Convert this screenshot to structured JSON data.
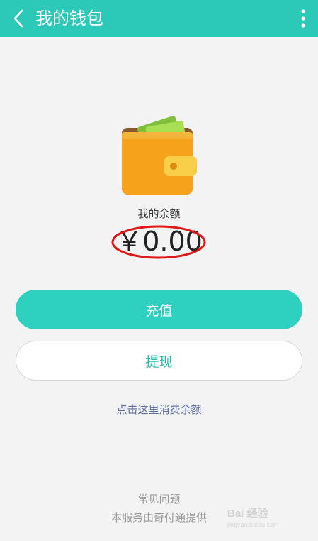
{
  "header": {
    "title": "我的钱包",
    "back_icon": "back-arrow-icon",
    "more_icon": "more-vert-icon"
  },
  "wallet": {
    "icon": "wallet-icon",
    "balance_label": "我的余额",
    "balance_amount": "￥0.00"
  },
  "actions": {
    "recharge_label": "充值",
    "withdraw_label": "提现"
  },
  "links": {
    "spend_balance": "点击这里消费余额",
    "faq": "常见问题",
    "provider": "本服务由奇付通提供"
  },
  "watermark": {
    "brand": "Bai 经验",
    "url": "jingyan.baidu.com"
  },
  "colors": {
    "header": "#2cc8b8",
    "primary_button": "#2ed1c0",
    "secondary_text": "#2cbcad",
    "link": "#5d6da0",
    "annotation_circle": "#e01818"
  }
}
